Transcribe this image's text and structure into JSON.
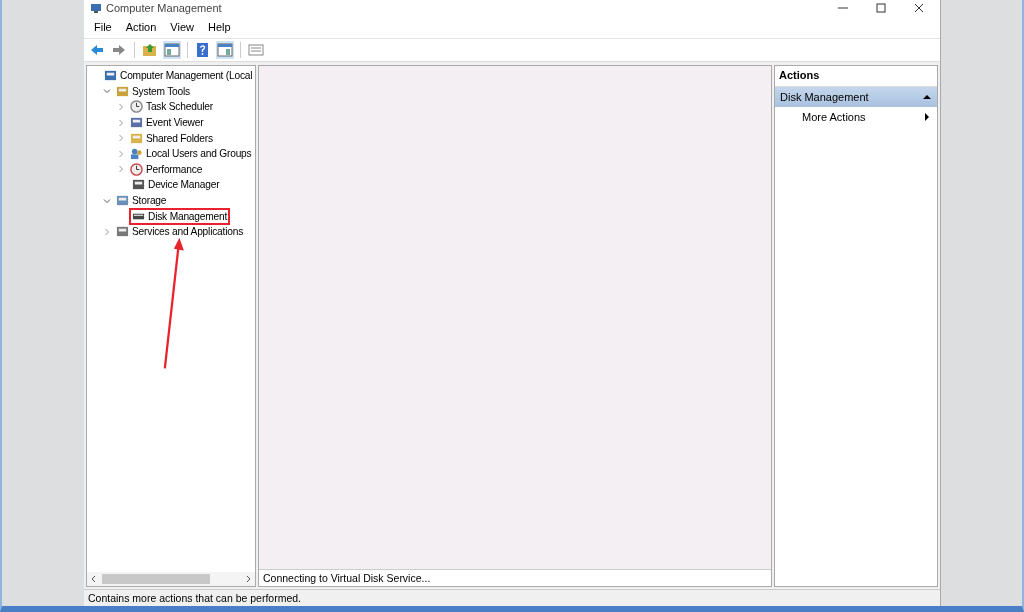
{
  "window": {
    "title": "Computer Management"
  },
  "menu": [
    "File",
    "Action",
    "View",
    "Help"
  ],
  "tree": [
    {
      "label": "Computer Management (Local",
      "kind": "computer",
      "highlighted": false,
      "children": [
        {
          "label": "System Tools",
          "kind": "tools",
          "expanded": true,
          "highlighted": false,
          "children": [
            {
              "label": "Task Scheduler",
              "kind": "clock",
              "expanded": false,
              "highlighted": false
            },
            {
              "label": "Event Viewer",
              "kind": "log",
              "expanded": false,
              "highlighted": false
            },
            {
              "label": "Shared Folders",
              "kind": "folder",
              "expanded": false,
              "highlighted": false
            },
            {
              "label": "Local Users and Groups",
              "kind": "users",
              "expanded": false,
              "highlighted": false
            },
            {
              "label": "Performance",
              "kind": "gauge",
              "expanded": false,
              "highlighted": false
            },
            {
              "label": "Device Manager",
              "kind": "device",
              "highlighted": false
            }
          ]
        },
        {
          "label": "Storage",
          "kind": "storage",
          "expanded": true,
          "highlighted": false,
          "children": [
            {
              "label": "Disk Management",
              "kind": "disk",
              "highlighted": true
            }
          ]
        },
        {
          "label": "Services and Applications",
          "kind": "services",
          "expanded": false,
          "highlighted": false
        }
      ]
    }
  ],
  "center_status": "Connecting to Virtual Disk Service...",
  "actions": {
    "title": "Actions",
    "items": [
      {
        "label": "Disk Management",
        "kind": "section",
        "selected": true
      },
      {
        "label": "More Actions",
        "kind": "submenu",
        "selected": false
      }
    ]
  },
  "status_bar": "Contains more actions that can be performed."
}
